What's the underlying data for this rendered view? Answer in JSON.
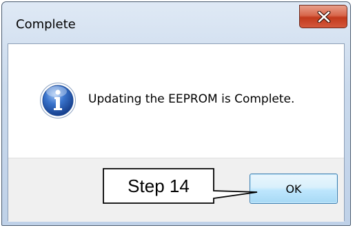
{
  "window": {
    "title": "Complete"
  },
  "titlebar": {
    "close_icon": "close-x-icon"
  },
  "message": {
    "icon": "info-icon",
    "text": "Updating the EEPROM is Complete."
  },
  "buttons": {
    "ok_label": "OK"
  },
  "annotation": {
    "step_label": "Step 14"
  },
  "colors": {
    "close_button": "#c94e32",
    "ok_button_border": "#3c7fb1",
    "info_icon_blue": "#2a5fb8"
  }
}
